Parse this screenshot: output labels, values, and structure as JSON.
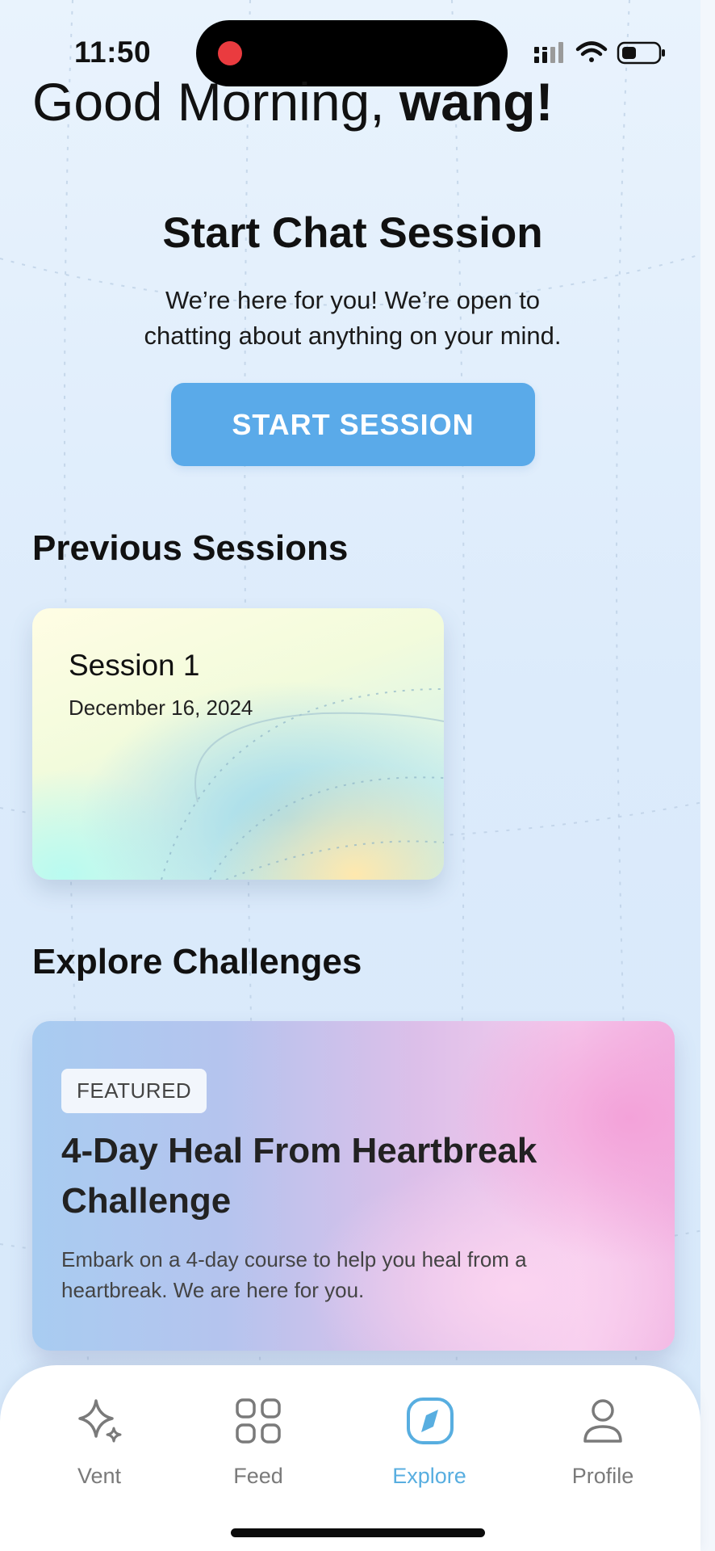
{
  "status_bar": {
    "time": "11:50",
    "icons": [
      "signal-icon",
      "wifi-icon",
      "battery-icon"
    ],
    "recording_color": "#ea3b3f"
  },
  "greeting": {
    "prefix": "Good Morning, ",
    "name": "wang!"
  },
  "chat": {
    "title": "Start Chat Session",
    "subtitle": "We’re here for you! We’re open to chatting about anything on your mind.",
    "button_label": "START SESSION",
    "button_color": "#5aaae9"
  },
  "previous_sessions": {
    "heading": "Previous Sessions",
    "items": [
      {
        "title": "Session 1",
        "date": "December 16, 2024"
      }
    ]
  },
  "challenges": {
    "heading": "Explore Challenges",
    "featured": {
      "badge": "FEATURED",
      "title": "4-Day Heal From Heartbreak Challenge",
      "description": "Embark on a 4-day course to help you heal from a heartbreak. We are here for you."
    }
  },
  "nav": {
    "active": "Explore",
    "active_color": "#58aee0",
    "items": [
      {
        "label": "Vent",
        "icon": "sparkle-icon"
      },
      {
        "label": "Feed",
        "icon": "grid-icon"
      },
      {
        "label": "Explore",
        "icon": "compass-icon"
      },
      {
        "label": "Profile",
        "icon": "user-icon"
      }
    ]
  }
}
